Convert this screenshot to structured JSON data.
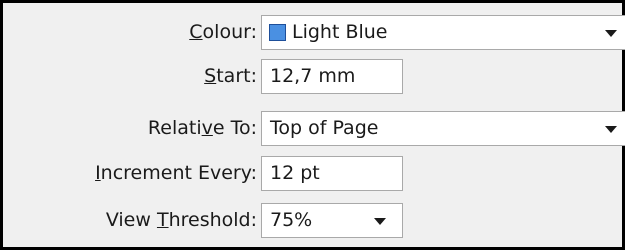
{
  "fields": {
    "colour": {
      "label_pre": "",
      "label_key": "C",
      "label_post": "olour:",
      "value": "Light Blue",
      "swatch_color": "#4a90e2"
    },
    "start": {
      "label_pre": "",
      "label_key": "S",
      "label_post": "tart:",
      "value": "12,7 mm"
    },
    "relative_to": {
      "label_pre": "Relati",
      "label_key": "v",
      "label_post": "e To:",
      "value": "Top of Page"
    },
    "increment_every": {
      "label_pre": "",
      "label_key": "I",
      "label_post": "ncrement Every:",
      "value": "12 pt"
    },
    "view_threshold": {
      "label_pre": "View ",
      "label_key": "T",
      "label_post": "hreshold:",
      "value": "75%"
    }
  }
}
